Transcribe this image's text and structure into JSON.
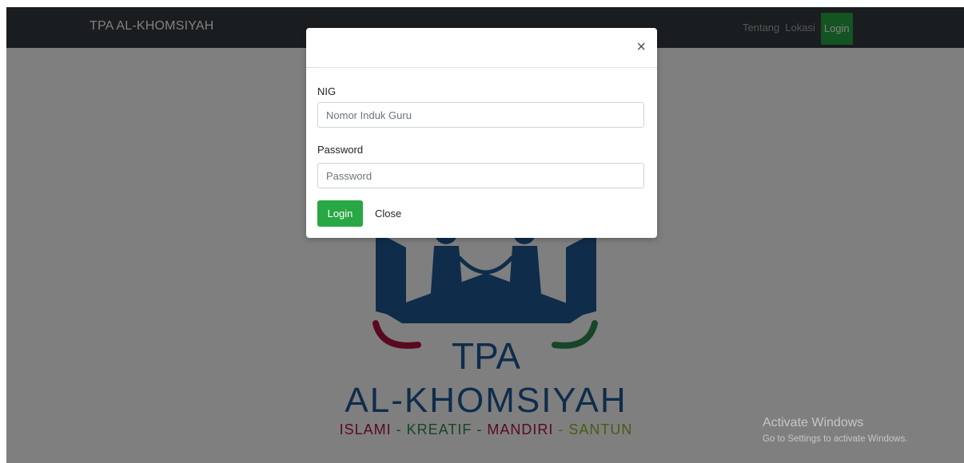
{
  "navbar": {
    "brand": "TPA AL-KHOMSIYAH",
    "links": [
      "Tentang",
      "Lokasi"
    ],
    "login_label": "Login"
  },
  "logo": {
    "title": "TPA",
    "name": "AL-KHOMSIYAH",
    "tagline": {
      "islami": "ISLAMI",
      "kreatif": "KREATIF",
      "mandiri": "MANDIRI",
      "santun": "SANTUN",
      "separator": " - "
    }
  },
  "modal": {
    "close_symbol": "×",
    "nig_label": "NIG",
    "nig_placeholder": "Nomor Induk Guru",
    "password_label": "Password",
    "password_placeholder": "Password",
    "login_button": "Login",
    "close_button": "Close"
  },
  "watermark": {
    "title": "Activate Windows",
    "subtitle": "Go to Settings to activate Windows."
  },
  "colors": {
    "navbar": "#343a40",
    "accent_green": "#28a745",
    "logo_blue": "#1e5a96",
    "logo_red": "#b3123f",
    "logo_green": "#2e8b4f",
    "tagline_green": "#8cb832"
  }
}
